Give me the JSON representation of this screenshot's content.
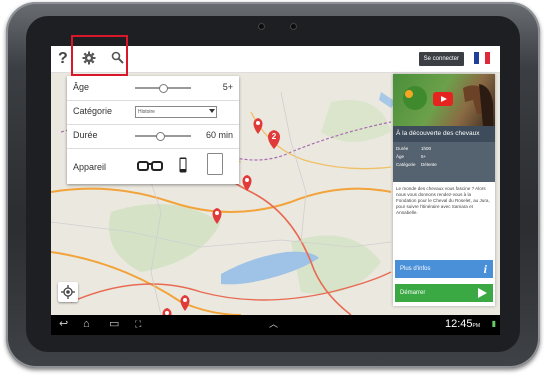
{
  "topbar": {
    "help_icon": "question-mark-icon",
    "settings_icon": "gear-icon",
    "search_icon": "magnifier-icon",
    "connect_label": "Se connecter",
    "flag_colors": [
      "#1f3f9a",
      "#ffffff",
      "#e0283a"
    ]
  },
  "filters": {
    "age": {
      "label": "Âge",
      "value": "5+",
      "level": 0.5
    },
    "category": {
      "label": "Catégorie",
      "selected": "Histoire"
    },
    "duration": {
      "label": "Durée",
      "value": "60 min",
      "level": 0.45
    },
    "device": {
      "label": "Appareil",
      "options": [
        "glasses-icon",
        "phone-icon",
        "tablet-icon"
      ]
    }
  },
  "card": {
    "title": "À la découverte des chevaux",
    "meta": [
      {
        "key": "Durée",
        "value": "1h00"
      },
      {
        "key": "Âge",
        "value": "5+"
      },
      {
        "key": "Catégorie",
        "value": "Détente"
      }
    ],
    "description": "Le monde des chevaux vous fascine ? Alors nous vous donnons rendez-vous à la Fondation pour le Cheval du Roselet, au Jura, pour suivre l'itinéraire avec Samara et Annabelle.",
    "more_label": "Plus d'infos",
    "start_label": "Démarrer",
    "more_color": "#4a90d9",
    "start_color": "#3aa843"
  },
  "map": {
    "cluster_label": "2",
    "marker_color": "#e03a3a"
  },
  "statusbar": {
    "time": "12:45",
    "ampm": "PM"
  }
}
